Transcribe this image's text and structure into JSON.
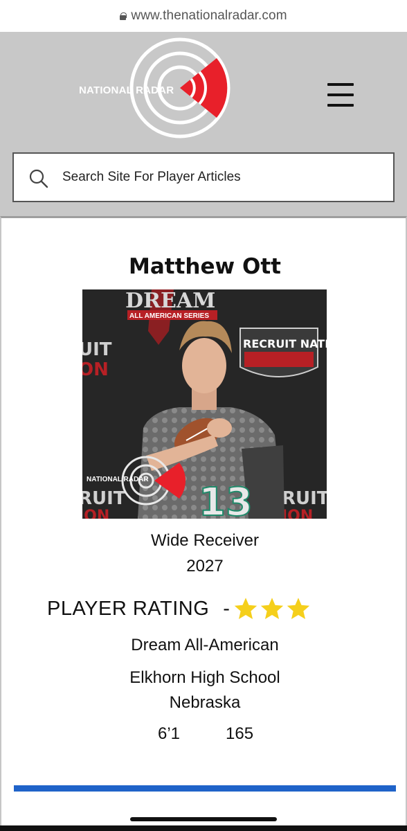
{
  "browser": {
    "url": "www.thenationalradar.com"
  },
  "header": {
    "logo_text": "NATIONAL RADAR",
    "search_placeholder": "Search Site For Player Articles"
  },
  "player": {
    "name": "Matthew Ott",
    "position": "Wide Receiver",
    "class_year": "2027",
    "rating_label": "PLAYER RATING",
    "rating_separator": "-",
    "rating_stars": 3,
    "award": "Dream All-American",
    "school": "Elkhorn High School",
    "state": "Nebraska",
    "height": "6’1",
    "weight": "165"
  },
  "photo": {
    "backdrop_logos": [
      "DREAM",
      "ALL AMERICAN SERIES",
      "RECRUIT NATION"
    ],
    "watermark_text": "NATIONAL RADAR",
    "jersey_number": "13"
  },
  "colors": {
    "header_bg": "#c8c8c8",
    "accent_red": "#e8202a",
    "rating_star": "#f5cf1b",
    "divider_blue": "#1f63c9"
  },
  "icons": [
    "lock-icon",
    "menu-icon",
    "search-icon",
    "star-icon"
  ]
}
